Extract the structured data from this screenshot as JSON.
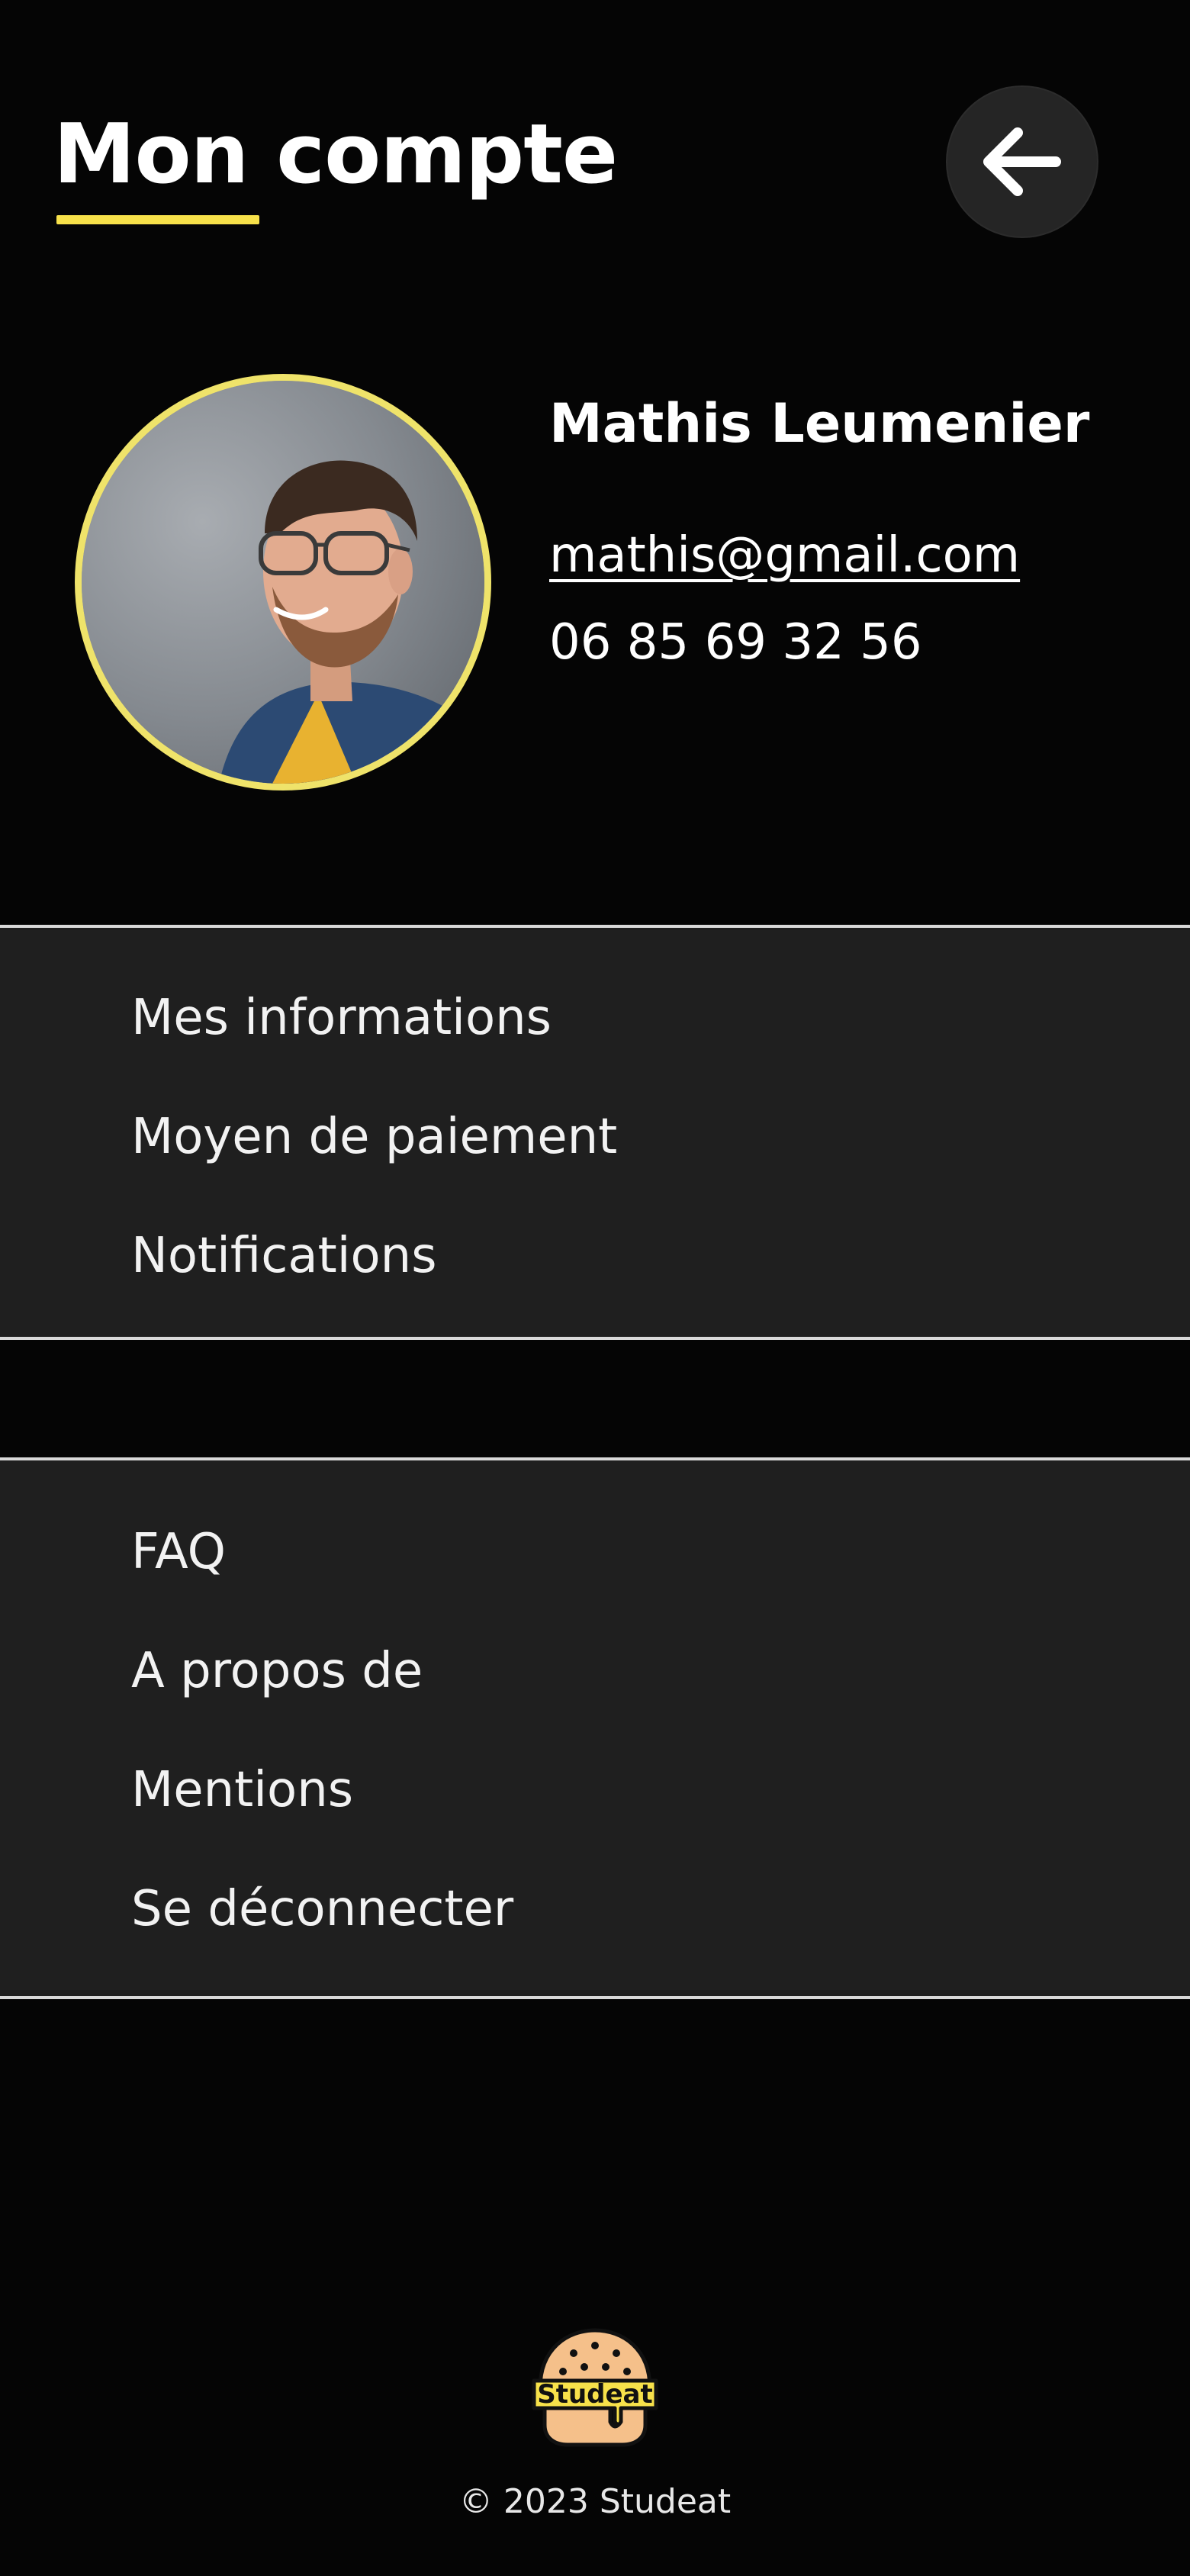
{
  "header": {
    "title": "Mon compte",
    "accent_color": "#f7e14a",
    "back_icon": "arrow-left-icon"
  },
  "profile": {
    "name": "Mathis Leumenier",
    "email": "mathis@gmail.com",
    "phone": "06 85 69 32 56",
    "avatar_ring_color": "#efe36a"
  },
  "menu_primary": {
    "items": [
      {
        "label": "Mes informations"
      },
      {
        "label": "Moyen de paiement"
      },
      {
        "label": "Notifications"
      }
    ]
  },
  "menu_secondary": {
    "items": [
      {
        "label": "FAQ"
      },
      {
        "label": "A propos de"
      },
      {
        "label": "Mentions"
      },
      {
        "label": "Se déconnecter"
      }
    ]
  },
  "footer": {
    "logo_text": "Studeat",
    "copyright": "© 2023 Studeat"
  },
  "colors": {
    "background": "#050505",
    "section_background": "#1f1f1f",
    "divider": "#d9d9d9",
    "logo_bun": "#f5c08a",
    "logo_band": "#f7e14a"
  }
}
